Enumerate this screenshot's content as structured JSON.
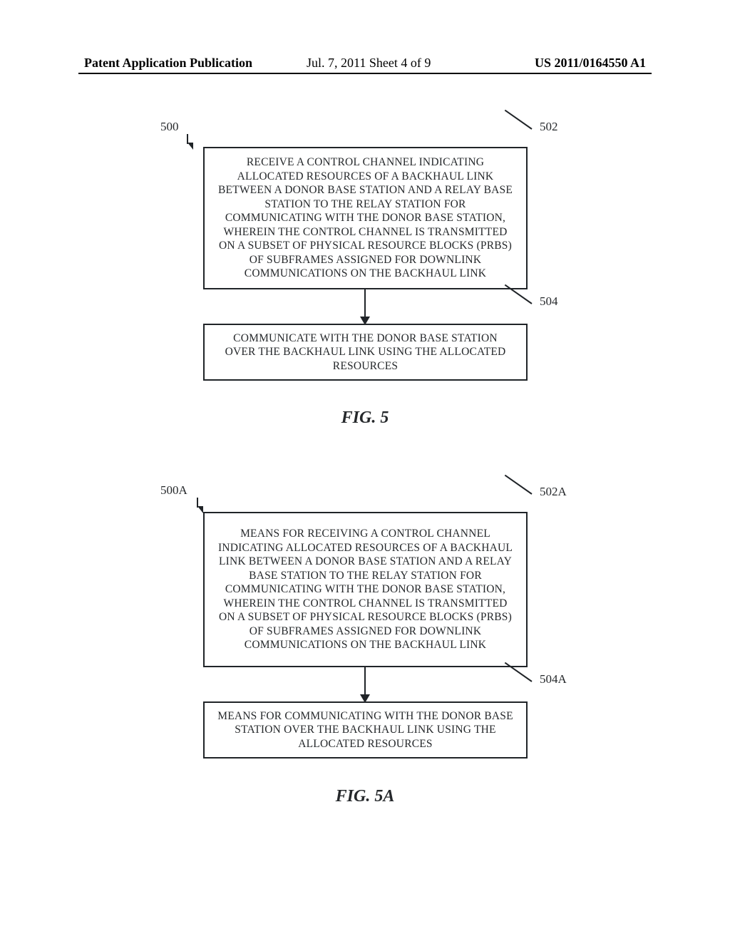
{
  "header": {
    "left": "Patent Application Publication",
    "center": "Jul. 7, 2011  Sheet 4 of 9",
    "right": "US 2011/0164550 A1"
  },
  "fig5": {
    "ref_origin": "500",
    "ref_box1": "502",
    "ref_box2": "504",
    "box1_text": "RECEIVE A CONTROL CHANNEL INDICATING ALLOCATED RESOURCES OF A BACKHAUL LINK BETWEEN A DONOR BASE STATION AND A RELAY BASE STATION TO THE RELAY STATION FOR COMMUNICATING WITH THE DONOR BASE STATION, WHEREIN THE CONTROL CHANNEL IS TRANSMITTED ON A SUBSET OF PHYSICAL RESOURCE BLOCKS (PRBS) OF SUBFRAMES ASSIGNED FOR DOWNLINK COMMUNICATIONS ON THE BACKHAUL LINK",
    "box2_text": "COMMUNICATE WITH THE DONOR BASE STATION OVER THE BACKHAUL LINK USING THE ALLOCATED RESOURCES",
    "label": "FIG. 5"
  },
  "fig5a": {
    "ref_origin": "500A",
    "ref_box1": "502A",
    "ref_box2": "504A",
    "box1_text": "MEANS FOR RECEIVING A CONTROL CHANNEL INDICATING ALLOCATED RESOURCES OF A BACKHAUL LINK BETWEEN A DONOR BASE STATION AND A RELAY BASE STATION TO THE RELAY STATION FOR COMMUNICATING WITH THE DONOR BASE STATION, WHEREIN THE CONTROL CHANNEL IS TRANSMITTED ON A SUBSET OF PHYSICAL RESOURCE BLOCKS (PRBS) OF SUBFRAMES ASSIGNED FOR DOWNLINK COMMUNICATIONS ON THE BACKHAUL LINK",
    "box2_text": "MEANS FOR COMMUNICATING WITH THE DONOR BASE STATION OVER THE BACKHAUL LINK USING THE ALLOCATED RESOURCES",
    "label": "FIG. 5A"
  }
}
